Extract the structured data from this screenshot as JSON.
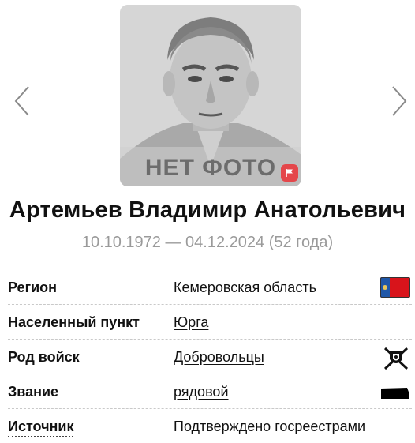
{
  "photo": {
    "caption": "НЕТ ФОТО"
  },
  "person": {
    "name": "Артемьев Владимир Анатольевич",
    "dates": "10.10.1972 — 04.12.2024 (52 года)"
  },
  "details": [
    {
      "label": "Регион",
      "value": "Кемеровская область",
      "icon": "region-flag-icon"
    },
    {
      "label": "Населенный пункт",
      "value": "Юрга",
      "icon": null
    },
    {
      "label": "Род войск",
      "value": "Добровольцы",
      "icon": "volunteers-emblem-icon"
    },
    {
      "label": "Звание",
      "value": "рядовой",
      "icon": "rank-insignia-icon"
    },
    {
      "label": "Источник",
      "value": "Подтверждено госреестрами",
      "icon": null
    }
  ],
  "colors": {
    "flag_blue": "#1f57a8",
    "flag_red": "#d8141b",
    "badge_red": "#e4474b",
    "dates_gray": "#9a9a9a"
  }
}
